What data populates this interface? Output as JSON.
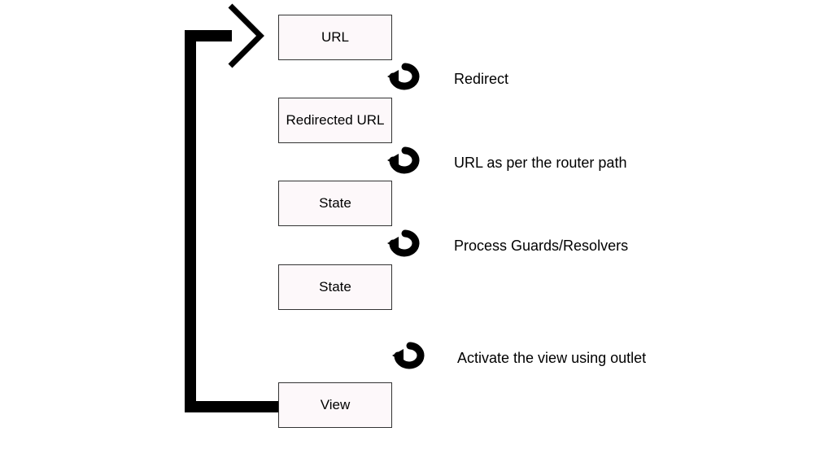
{
  "boxes": {
    "url": "URL",
    "redirected": "Redirected URL",
    "state1": "State",
    "state2": "State",
    "view": "View"
  },
  "labels": {
    "redirect": "Redirect",
    "routerPath": "URL as per the router path",
    "guards": "Process Guards/Resolvers",
    "activate": "Activate the view using outlet"
  }
}
